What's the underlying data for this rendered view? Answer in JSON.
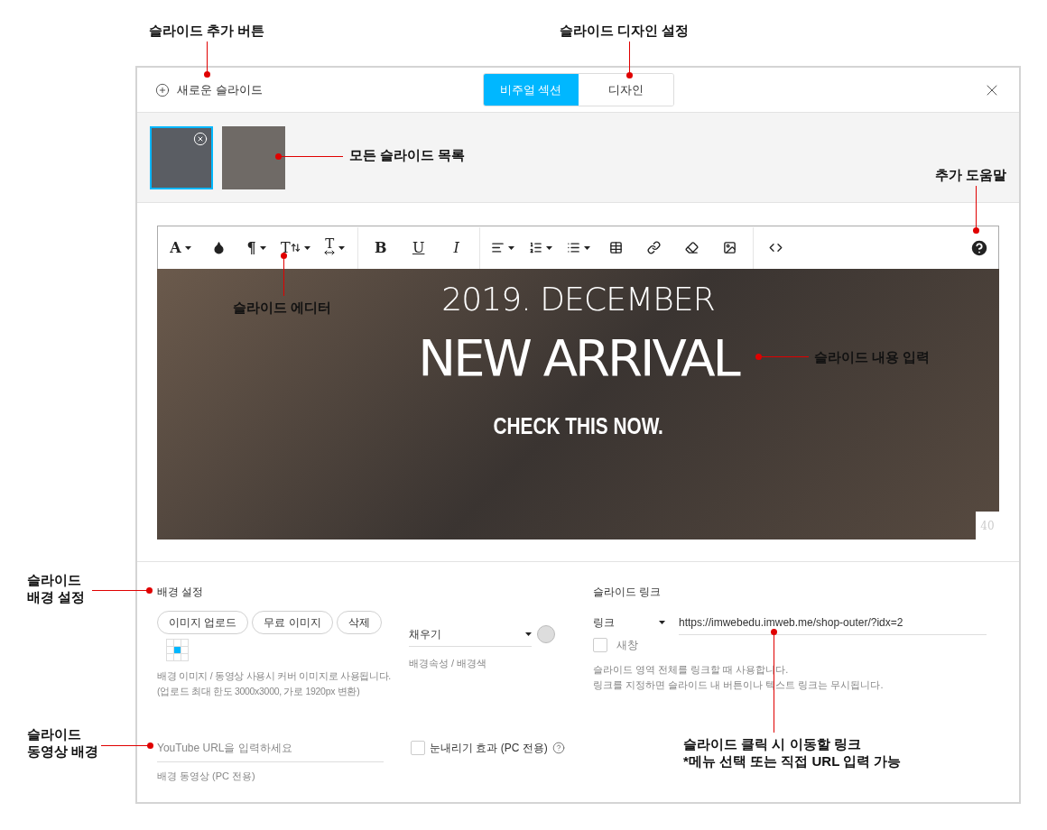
{
  "header": {
    "new_slide": "새로운 슬라이드",
    "tabs": [
      {
        "label": "비주얼 섹션",
        "selected": true
      },
      {
        "label": "디자인",
        "selected": false
      }
    ]
  },
  "thumbnails": [
    {
      "selected": true
    },
    {
      "selected": false
    }
  ],
  "toolbar": [
    {
      "kind": "text",
      "label": "A",
      "caret": true
    },
    {
      "kind": "drop",
      "caret": false
    },
    {
      "kind": "text",
      "label": "¶",
      "caret": true
    },
    {
      "kind": "height",
      "label": "T",
      "caret": true
    },
    {
      "kind": "width",
      "label": "T",
      "caret": true
    },
    {
      "kind": "sep"
    },
    {
      "kind": "text",
      "label": "B",
      "caret": false
    },
    {
      "kind": "text",
      "label": "U",
      "caret": false
    },
    {
      "kind": "text",
      "label": "I",
      "caret": false
    },
    {
      "kind": "sep"
    },
    {
      "kind": "align",
      "caret": true
    },
    {
      "kind": "ordered",
      "caret": true
    },
    {
      "kind": "bullets",
      "caret": true
    },
    {
      "kind": "table",
      "caret": false
    },
    {
      "kind": "link",
      "caret": false
    },
    {
      "kind": "eraser",
      "caret": false
    },
    {
      "kind": "image",
      "caret": false
    },
    {
      "kind": "sep"
    },
    {
      "kind": "code",
      "caret": false
    }
  ],
  "slide": {
    "subtitle": "2019. DECEMBER",
    "title": "NEW ARRIVAL",
    "tagline": "CHECK THIS NOW.",
    "counter": "40"
  },
  "background": {
    "label": "배경 설정",
    "buttons": [
      "이미지 업로드",
      "무료 이미지",
      "삭제"
    ],
    "hint": "배경 이미지 / 동영상 사용시 커버 이미지로 사용됩니다.\n(업로드 최대 한도 3000x3000, 가로 1920px 변환)"
  },
  "fill": {
    "value": "채우기",
    "hint": "배경속성 / 배경색"
  },
  "link": {
    "label": "슬라이드 링크",
    "type": "링크",
    "url": "https://imwebedu.imweb.me/shop-outer/?idx=2",
    "new_window": {
      "label": "새창",
      "checked": false
    },
    "hint": "슬라이드 영역 전체를 링크할 때 사용합니다.\n링크를 지정하면 슬라이드 내 버튼이나 텍스트 링크는 무시됩니다."
  },
  "video": {
    "placeholder": "YouTube URL을 입력하세요",
    "hint": "배경 동영상 (PC 전용)"
  },
  "snow": {
    "label": "눈내리기 효과 (PC 전용)",
    "checked": false
  },
  "annotations": [
    {
      "text": "슬라이드 추가 버튼"
    },
    {
      "text": "슬라이드 디자인 설정"
    },
    {
      "text": "모든 슬라이드 목록"
    },
    {
      "text": "추가 도움말"
    },
    {
      "text": "슬라이드 에디터"
    },
    {
      "text": "슬라이드 내용 입력"
    },
    {
      "text": "슬라이드\n배경 설정"
    },
    {
      "text": "슬라이드\n동영상 배경"
    },
    {
      "text": "슬라이드 클릭 시 이동할 링크\n*메뉴 선택 또는 직접 URL 입력 가능"
    }
  ]
}
